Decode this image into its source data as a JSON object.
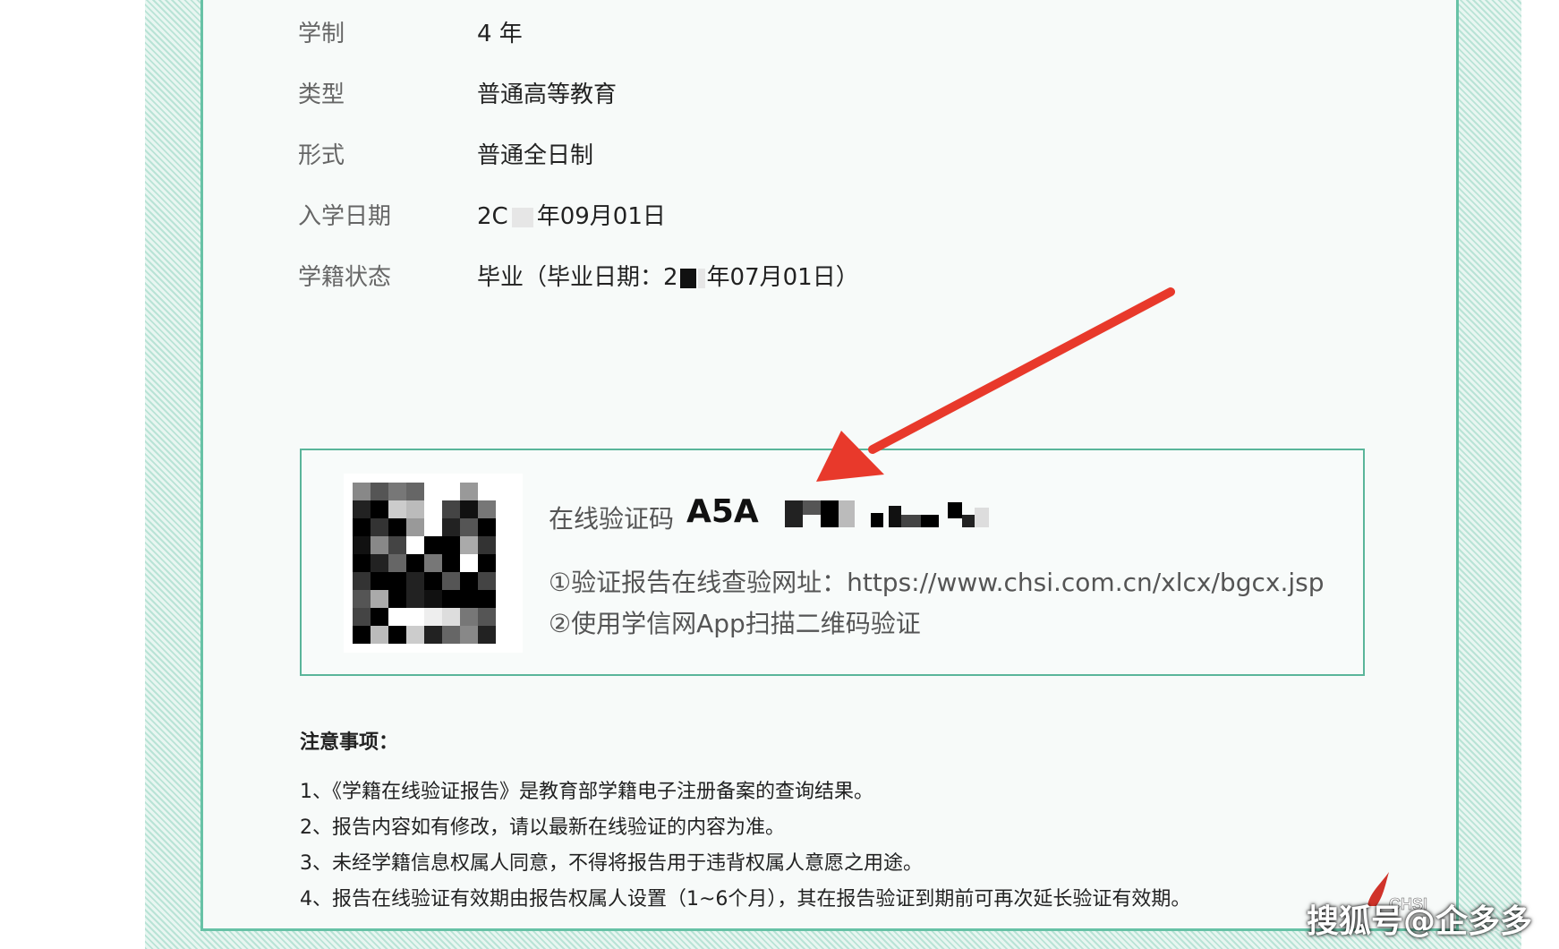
{
  "fields": [
    {
      "label": "学制",
      "value": "4 年"
    },
    {
      "label": "类型",
      "value": "普通高等教育"
    },
    {
      "label": "形式",
      "value": "普通全日制"
    },
    {
      "label": "入学日期",
      "value_prefix": "2C",
      "value_suffix": "年09月01日"
    },
    {
      "label": "学籍状态",
      "value_prefix": "毕业（毕业日期：2",
      "value_suffix": "年07月01日）"
    }
  ],
  "verification": {
    "code_label": "在线验证码",
    "code_visible": "A5A",
    "line1": "①验证报告在线查验网址：https://www.chsi.com.cn/xlcx/bgcx.jsp",
    "line2": "②使用学信网App扫描二维码验证"
  },
  "notes": {
    "title": "注意事项：",
    "items": [
      "1、《学籍在线验证报告》是教育部学籍电子注册备案的查询结果。",
      "2、报告内容如有修改，请以最新在线验证的内容为准。",
      "3、未经学籍信息权属人同意，不得将报告用于违背权属人意愿之用途。",
      "4、报告在线验证有效期由报告权属人设置（1~6个月），其在报告验证到期前可再次延长验证有效期。"
    ]
  },
  "watermark": "搜狐号@企多多",
  "logo_text": "CHSI",
  "colors": {
    "border": "#5ab59a",
    "arrow": "#e8392b"
  }
}
